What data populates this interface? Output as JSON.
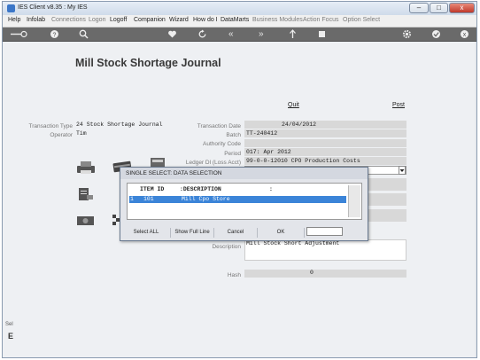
{
  "window": {
    "title": "IES Client v8.35 : My IES",
    "controls": {
      "minimize": "–",
      "maximize": "□",
      "close": "x"
    }
  },
  "menu": {
    "items": [
      {
        "label": "Help",
        "enabled": true
      },
      {
        "label": "Infolab",
        "enabled": true
      },
      {
        "label": "Connections",
        "enabled": false
      },
      {
        "label": "Logon",
        "enabled": false
      },
      {
        "label": "Logoff",
        "enabled": true
      },
      {
        "label": "Companion",
        "enabled": true
      },
      {
        "label": "Wizard",
        "enabled": true
      },
      {
        "label": "How do I",
        "enabled": true
      },
      {
        "label": "DataMarts",
        "enabled": true
      },
      {
        "label": "Business Modules",
        "enabled": false
      },
      {
        "label": "Action Focus",
        "enabled": false
      },
      {
        "label": "Option Select",
        "enabled": false
      }
    ]
  },
  "toolbar": {
    "icons": [
      "back-key-icon",
      "help-icon",
      "search-icon",
      "heart-icon",
      "refresh-icon",
      "rewind-icon",
      "fast-forward-icon",
      "up-arrow-icon",
      "stop-icon",
      "settings-icon",
      "check-icon",
      "close-icon"
    ],
    "glyphs": {
      "help": "?",
      "rewind": "«",
      "forward": "»",
      "close": "x"
    }
  },
  "page": {
    "title": "Mill Stock Shortage Journal",
    "quit_label": "Quit",
    "post_label": "Post"
  },
  "form": {
    "transaction_type_label": "Transaction Type",
    "transaction_type_value": "24 Stock Shortage Journal",
    "operator_label": "Operator",
    "operator_value": "Tim",
    "transaction_date_label": "Transaction Date",
    "transaction_date_value": "24/04/2012",
    "batch_label": "Batch",
    "batch_value": "TT-240412",
    "authority_code_label": "Authority Code",
    "authority_code_value": "",
    "period_label": "Period",
    "period_value": "017: Apr 2012",
    "ledger_dl_label": "Ledger Dl (Loss Acct)",
    "ledger_dl_value": "99-0-0-12010 CPO Production Costs",
    "description_label": "Description",
    "description_value": "Mill Stock Short Adjustment",
    "hash_label": "Hash",
    "hash_value": "0"
  },
  "dialog": {
    "title": "SINGLE SELECT: DATA SELECTION",
    "col_item_id": "ITEM ID",
    "col_description": ":DESCRIPTION",
    "col_extra": ":",
    "rows": [
      {
        "num": "1",
        "item_id": "101",
        "description": "Mill Cpo Store"
      }
    ],
    "buttons": {
      "select_all": "Select ALL",
      "show_full_line": "Show Full Line",
      "cancel": "Cancel",
      "ok": "OK"
    },
    "input_value": ""
  },
  "footer": {
    "left_text": "Sel",
    "left_letter": "E"
  }
}
